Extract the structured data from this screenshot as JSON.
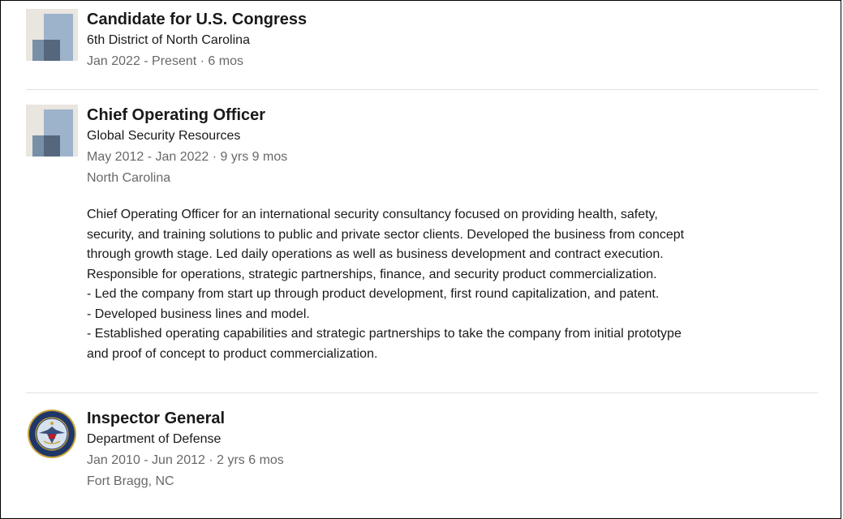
{
  "experience": [
    {
      "logo": "placeholder-company-logo",
      "title": "Candidate for U.S. Congress",
      "company": "6th District of North Carolina",
      "dates": "Jan 2022 - Present · 6 mos"
    },
    {
      "logo": "placeholder-company-logo",
      "title": "Chief Operating Officer",
      "company": "Global Security Resources",
      "dates": "May 2012 - Jan 2022 · 9 yrs 9 mos",
      "location": "North Carolina",
      "description": "Chief Operating Officer for an international security consultancy focused on providing health, safety,\nsecurity, and training solutions to public and private sector clients. Developed the business from concept\nthrough growth stage. Led daily operations as well as business development and contract execution.\nResponsible for operations, strategic partnerships, finance, and security product commercialization.\n- Led the company from start up through product development, first round capitalization, and patent.\n- Developed business lines and model.\n- Established operating capabilities and strategic partnerships to take the company from initial prototype\nand proof of concept to product commercialization."
    },
    {
      "logo": "dod-seal-logo",
      "title": "Inspector General",
      "company": "Department of Defense",
      "dates": "Jan 2010 - Jun 2012 · 2 yrs 6 mos",
      "location": "Fort Bragg, NC"
    }
  ],
  "colors": {
    "logo_bg": "#e9e5df",
    "logo_light": "#9db3cc",
    "logo_mid": "#788fa8",
    "logo_dark": "#56677d",
    "seal_navy": "#1f3768",
    "seal_gold": "#c9a43b"
  }
}
